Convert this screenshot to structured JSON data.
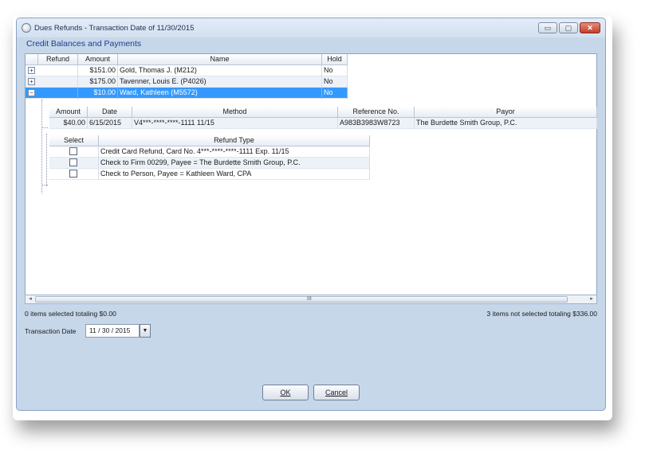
{
  "window": {
    "title": "Dues Refunds - Transaction Date of 11/30/2015",
    "section_header": "Credit Balances and Payments"
  },
  "main_grid": {
    "columns": [
      "Refund",
      "Amount",
      "Name",
      "Hold"
    ],
    "rows": [
      {
        "refund": "",
        "amount": "$151.00",
        "name": "Gold, Thomas J. (M212)",
        "hold": "No",
        "expander": "+"
      },
      {
        "refund": "",
        "amount": "$175.00",
        "name": "Tavenner, Louis E. (P4026)",
        "hold": "No",
        "expander": "+"
      },
      {
        "refund": "",
        "amount": "$10.00",
        "name": "Ward, Kathleen (M5572)",
        "hold": "No",
        "expander": "−",
        "selected": true
      }
    ]
  },
  "payments_grid": {
    "columns": [
      "Amount",
      "Date",
      "Method",
      "Reference No.",
      "Payor"
    ],
    "rows": [
      {
        "amount": "$40.00",
        "date": "6/15/2015",
        "method": "V4***-****-****-1111 11/15",
        "reference": "A983B3983W8723",
        "payor": "The Burdette Smith Group, P.C."
      }
    ]
  },
  "refund_type_grid": {
    "columns": [
      "Select",
      "Refund Type"
    ],
    "rows": [
      {
        "selected": false,
        "type": "Credit Card Refund, Card No. 4***-****-****-1111 Exp. 11/15"
      },
      {
        "selected": false,
        "type": "Check to Firm 00299, Payee = The Burdette Smith Group, P.C."
      },
      {
        "selected": false,
        "type": "Check to Person, Payee = Kathleen Ward, CPA"
      }
    ]
  },
  "scrollbar": {
    "grip": "III",
    "left_arrow": "◂",
    "right_arrow": "▸"
  },
  "status": {
    "selected_summary": "0 items selected totaling $0.00",
    "not_selected_summary": "3 items not selected totaling $336.00"
  },
  "transaction_date": {
    "label": "Transaction Date",
    "value": "11 / 30 / 2015",
    "dropdown_glyph": "▼"
  },
  "buttons": {
    "ok_label": "OK",
    "cancel_label": "Cancel"
  },
  "title_buttons": {
    "minimize": "▭",
    "maximize": "▢",
    "close": "✕"
  },
  "colors": {
    "selection": "#3399ff",
    "header_text": "#1f3d8c",
    "window_bg": "#c7d7ea"
  }
}
